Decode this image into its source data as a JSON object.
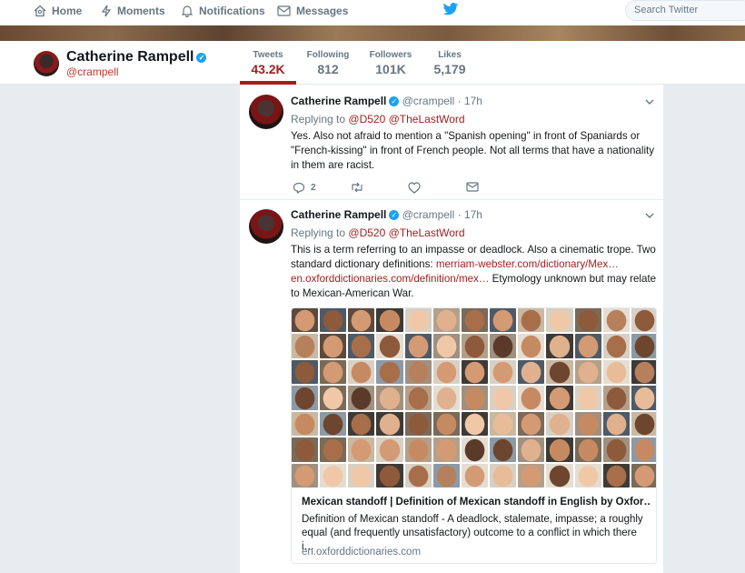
{
  "nav": {
    "home": "Home",
    "moments": "Moments",
    "notifications": "Notifications",
    "messages": "Messages",
    "search_placeholder": "Search Twitter"
  },
  "profile": {
    "name": "Catherine Rampell",
    "handle": "@crampell",
    "stats": [
      {
        "label": "Tweets",
        "value": "43.2K"
      },
      {
        "label": "Following",
        "value": "812"
      },
      {
        "label": "Followers",
        "value": "101K"
      },
      {
        "label": "Likes",
        "value": "5,179"
      }
    ]
  },
  "tweets": [
    {
      "name": "Catherine Rampell",
      "handle": "@crampell",
      "time": "· 17h",
      "replying_prefix": "Replying to",
      "replying_to_1": "@D520",
      "replying_to_2": "@TheLastWord",
      "text": "Yes. Also not afraid to mention a \"Spanish opening\" in front of Spaniards or \"French-kissing\" in front of French people. Not all terms that have a nationality in them are racist.",
      "reply_count": "2"
    },
    {
      "name": "Catherine Rampell",
      "handle": "@crampell",
      "time": "· 17h",
      "replying_prefix": "Replying to",
      "replying_to_1": "@D520",
      "replying_to_2": "@TheLastWord",
      "text_1": "This is a term referring to an impasse or deadlock. Also a cinematic trope. Two standard dictionary definitions: ",
      "link_1": "merriam-webster.com/dictionary/Mex…",
      "link_2": "en.oxforddictionaries.com/definition/mex…",
      "text_2": " Etymology unknown but may relate to Mexican-American War.",
      "card": {
        "title": "Mexican standoff | Definition of Mexican standoff in English by Oxfor…",
        "description": "Definition of Mexican standoff - A deadlock, stalemate, impasse; a roughly equal (and frequently unsatisfactory) outcome to a conflict in which there i…",
        "url": "en.oxforddictionaries.com"
      }
    }
  ],
  "colors": {
    "accent": "#a31f1f",
    "twitter_blue": "#1da1f2",
    "muted": "#657786"
  }
}
